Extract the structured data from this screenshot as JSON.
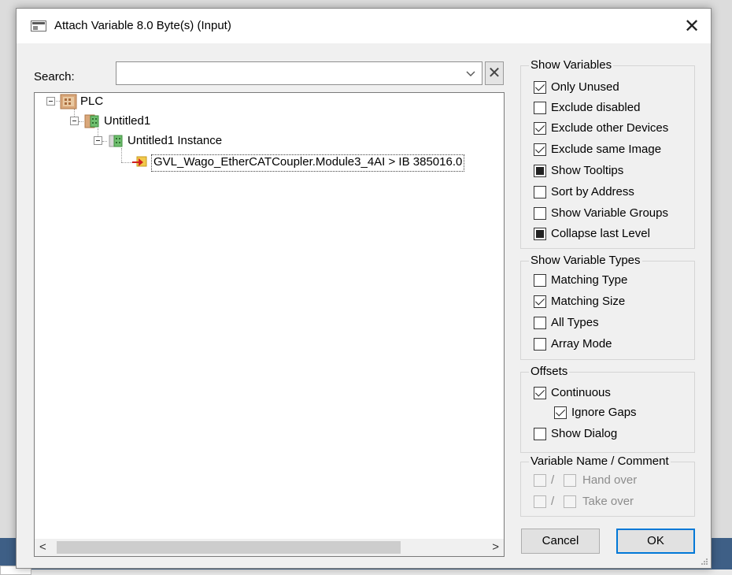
{
  "dialog": {
    "title": "Attach Variable 8.0 Byte(s) (Input)",
    "close_glyph": "✕"
  },
  "search": {
    "label": "Search:",
    "value": "",
    "placeholder": "",
    "clear_glyph": "✕"
  },
  "tree": {
    "nodes": [
      {
        "label": "PLC",
        "icon": "plc-project-icon"
      },
      {
        "label": "Untitled1",
        "icon": "plc-module-icon"
      },
      {
        "label": "Untitled1 Instance",
        "icon": "plc-instance-icon"
      },
      {
        "label": "GVL_Wago_EtherCATCoupler.Module3_4AI   >   IB 385016.0",
        "icon": "input-variable-icon"
      }
    ]
  },
  "scrollbar": {
    "left_glyph": "<",
    "right_glyph": ">"
  },
  "show_variables": {
    "title": "Show Variables",
    "items": [
      {
        "label": "Only Unused",
        "state": "checked"
      },
      {
        "label": "Exclude disabled",
        "state": "unchecked"
      },
      {
        "label": "Exclude other Devices",
        "state": "checked"
      },
      {
        "label": "Exclude same Image",
        "state": "checked"
      },
      {
        "label": "Show Tooltips",
        "state": "indeterminate"
      },
      {
        "label": "Sort by Address",
        "state": "unchecked"
      },
      {
        "label": "Show Variable Groups",
        "state": "unchecked"
      },
      {
        "label": "Collapse last Level",
        "state": "indeterminate"
      }
    ]
  },
  "show_variable_types": {
    "title": "Show Variable Types",
    "items": [
      {
        "label": "Matching Type",
        "state": "unchecked"
      },
      {
        "label": "Matching Size",
        "state": "checked"
      },
      {
        "label": "All Types",
        "state": "unchecked"
      },
      {
        "label": "Array Mode",
        "state": "unchecked"
      }
    ]
  },
  "offsets": {
    "title": "Offsets",
    "items": [
      {
        "label": "Continuous",
        "state": "checked"
      },
      {
        "label": "Ignore Gaps",
        "state": "checked"
      },
      {
        "label": "Show Dialog",
        "state": "unchecked"
      }
    ]
  },
  "variable_name_comment": {
    "title": "Variable Name / Comment",
    "separator": "/",
    "items": [
      {
        "label": "Hand over"
      },
      {
        "label": "Take over"
      }
    ]
  },
  "buttons": {
    "cancel": "Cancel",
    "ok": "OK"
  },
  "colors": {
    "default_button_border": "#0078d7",
    "background_strip": "#3e5f86"
  }
}
